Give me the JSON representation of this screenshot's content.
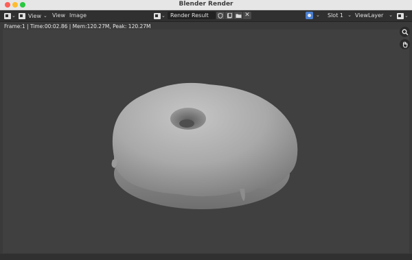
{
  "window": {
    "title": "Blender Render"
  },
  "header": {
    "view_label": "View",
    "menu": [
      "View",
      "Image"
    ],
    "image_name": "Render Result",
    "slot": "Slot 1",
    "view_layer": "ViewLayer"
  },
  "status": {
    "text": "Frame:1 | Time:00:02.86 | Mem:120.27M, Peak: 120.27M"
  },
  "icons": {
    "editor_type": "image-editor-icon",
    "mode": "image-mode-icon",
    "browse": "browse-image-icon",
    "fake_user": "shield-icon",
    "new_image": "new-image-icon",
    "open_image": "folder-icon",
    "unlink": "close-icon",
    "display_channels": "display-channels-icon",
    "gizmo": "gizmo-toggle-icon",
    "zoom": "zoom-icon",
    "pan": "hand-icon"
  },
  "colors": {
    "viewport_bg": "#404040",
    "header_bg": "#303030",
    "accent": "#4a7fd0"
  }
}
